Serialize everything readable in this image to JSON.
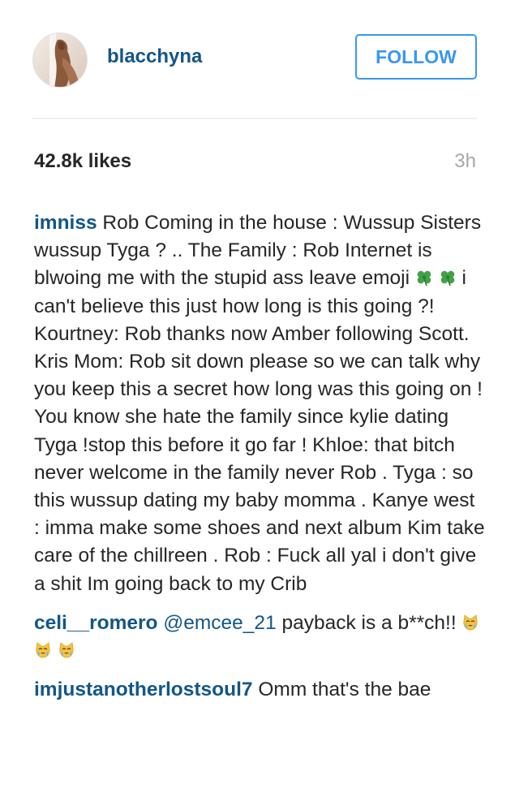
{
  "post": {
    "author": "blacchyna",
    "follow_label": "FOLLOW",
    "likes": "42.8k likes",
    "time_ago": "3h"
  },
  "comments": [
    {
      "user": "imniss",
      "text_1": " Rob Coming in the house : Wussup Sisters wussup Tyga ? .. The Family : Rob Internet is blwoing me with the stupid ass leave emoji ",
      "emojis": [
        "four-leaf-clover-icon",
        "four-leaf-clover-icon"
      ],
      "text_2": " i can't believe this just how long is this going ?! Kourtney: Rob thanks now Amber following Scott. Kris Mom: Rob sit down please so we can talk why you keep this a secret how long was this going on ! You know she hate the family since kylie dating Tyga !stop this before it go far ! Khloe: that bitch never welcome in the family never Rob . Tyga : so this wussup dating my baby momma . Kanye west : imma make some shoes and next album Kim take care of the chillreen . Rob : Fuck all yal i don't give a shit Im going back to my Crib"
    },
    {
      "user": "celi__romero",
      "mention": "@emcee_21",
      "text": " payback is a b**ch!! ",
      "emojis": [
        "crying-cat-face-icon",
        "crying-cat-face-icon",
        "crying-cat-face-icon"
      ]
    },
    {
      "user": "imjustanotherlostsoul7",
      "text": " Omm that's the bae"
    }
  ],
  "colors": {
    "link_blue": "#125688",
    "follow_blue": "#3897f0",
    "text": "#262626",
    "muted": "#a5a7aa",
    "divider": "#efefef"
  }
}
